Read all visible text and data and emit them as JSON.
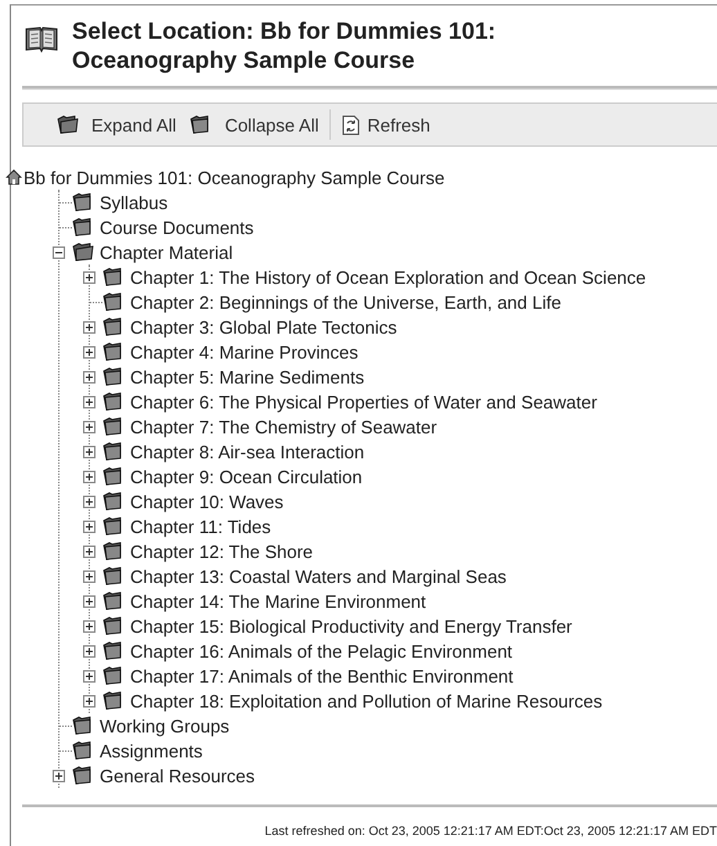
{
  "header": {
    "title": "Select Location: Bb for Dummies 101: Oceanography Sample Course"
  },
  "toolbar": [
    {
      "kind": "expand",
      "label": "Expand All"
    },
    {
      "kind": "collapse",
      "label": "Collapse All"
    },
    {
      "kind": "refresh",
      "label": "Refresh"
    }
  ],
  "tree": {
    "label": "Bb for Dummies 101: Oceanography Sample Course",
    "children": [
      {
        "label": "Syllabus",
        "kind": "leaf"
      },
      {
        "label": "Course Documents",
        "kind": "leaf"
      },
      {
        "label": "Chapter Material",
        "kind": "expanded",
        "children": [
          {
            "label": "Chapter 1: The History of Ocean Exploration and Ocean Science",
            "kind": "collapsed"
          },
          {
            "label": "Chapter 2: Beginnings of the Universe, Earth, and Life",
            "kind": "leaf"
          },
          {
            "label": "Chapter 3: Global Plate Tectonics",
            "kind": "collapsed"
          },
          {
            "label": "Chapter 4: Marine Provinces",
            "kind": "collapsed"
          },
          {
            "label": "Chapter 5: Marine Sediments",
            "kind": "collapsed"
          },
          {
            "label": "Chapter 6: The Physical Properties of Water and Seawater",
            "kind": "collapsed"
          },
          {
            "label": "Chapter 7: The Chemistry of Seawater",
            "kind": "collapsed"
          },
          {
            "label": "Chapter 8: Air-sea Interaction",
            "kind": "collapsed"
          },
          {
            "label": "Chapter 9: Ocean Circulation",
            "kind": "collapsed"
          },
          {
            "label": "Chapter 10: Waves",
            "kind": "collapsed"
          },
          {
            "label": "Chapter 11: Tides",
            "kind": "collapsed"
          },
          {
            "label": "Chapter 12: The Shore",
            "kind": "collapsed"
          },
          {
            "label": "Chapter 13: Coastal Waters and Marginal Seas",
            "kind": "collapsed"
          },
          {
            "label": "Chapter 14: The Marine Environment",
            "kind": "collapsed"
          },
          {
            "label": "Chapter 15: Biological Productivity and Energy Transfer",
            "kind": "collapsed"
          },
          {
            "label": "Chapter 16: Animals of the Pelagic Environment",
            "kind": "collapsed"
          },
          {
            "label": "Chapter 17: Animals of the Benthic Environment",
            "kind": "collapsed"
          },
          {
            "label": "Chapter 18: Exploitation and Pollution of Marine Resources",
            "kind": "collapsed"
          }
        ]
      },
      {
        "label": "Working Groups",
        "kind": "leaf"
      },
      {
        "label": "Assignments",
        "kind": "leaf"
      },
      {
        "label": "General Resources",
        "kind": "collapsed"
      }
    ]
  },
  "footer": {
    "text": "Last refreshed on: Oct 23, 2005 12:21:17 AM EDT:Oct 23, 2005 12:21:17 AM EDT"
  }
}
